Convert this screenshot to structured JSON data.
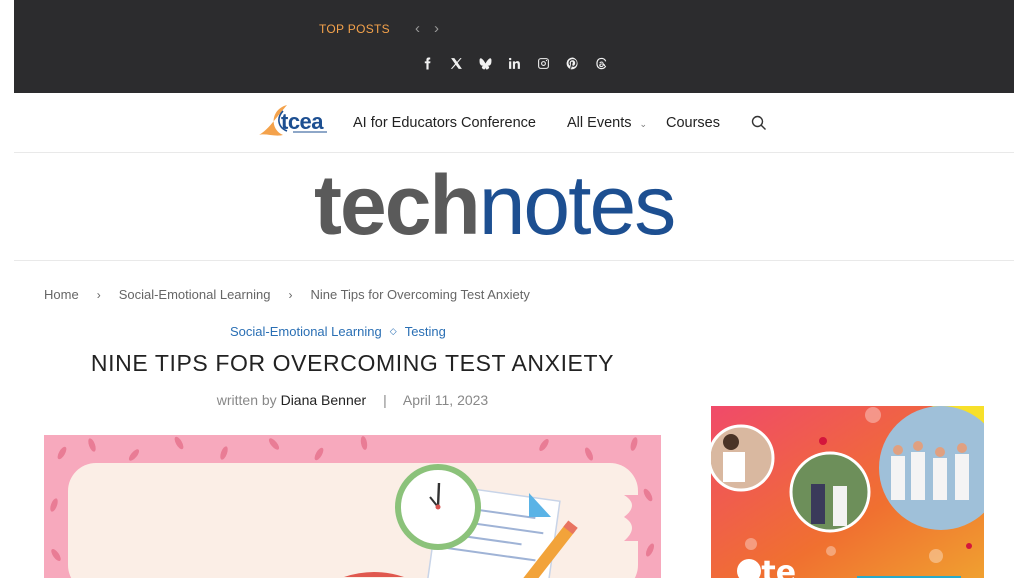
{
  "topbar": {
    "top_posts_label": "TOP POSTS",
    "prev_arrow": "‹",
    "next_arrow": "›",
    "socials": [
      {
        "icon": "facebook-icon",
        "glyph": "f"
      },
      {
        "icon": "x-icon",
        "glyph": "𝕏"
      },
      {
        "icon": "bluesky-icon",
        "glyph": ""
      },
      {
        "icon": "linkedin-icon",
        "glyph": "in"
      },
      {
        "icon": "instagram-icon",
        "glyph": ""
      },
      {
        "icon": "pinterest-icon",
        "glyph": ""
      },
      {
        "icon": "threads-icon",
        "glyph": "@"
      }
    ],
    "accent": "#f4a24b",
    "background": "#2c2c2e"
  },
  "navbar": {
    "logo_text": "tcea",
    "menu": [
      {
        "label": "AI for Educators Conference"
      },
      {
        "label": "All Events",
        "has_dropdown": true
      },
      {
        "label": "Courses"
      }
    ],
    "search_icon": "search-icon"
  },
  "masthead": {
    "part1": "tech",
    "part2": "notes",
    "colors": {
      "tech": "#5a5a5a",
      "notes": "#1d4f91"
    }
  },
  "breadcrumb": {
    "items": [
      "Home",
      "Social-Emotional Learning",
      "Nine Tips for Overcoming Test Anxiety"
    ]
  },
  "post": {
    "categories": [
      "Social-Emotional Learning",
      "Testing"
    ],
    "title": "NINE TIPS FOR OVERCOMING TEST ANXIETY",
    "written_by": "written by",
    "author": "Diana Benner",
    "date": "April 11, 2023"
  },
  "ad": {
    "partial_text": "ete"
  }
}
